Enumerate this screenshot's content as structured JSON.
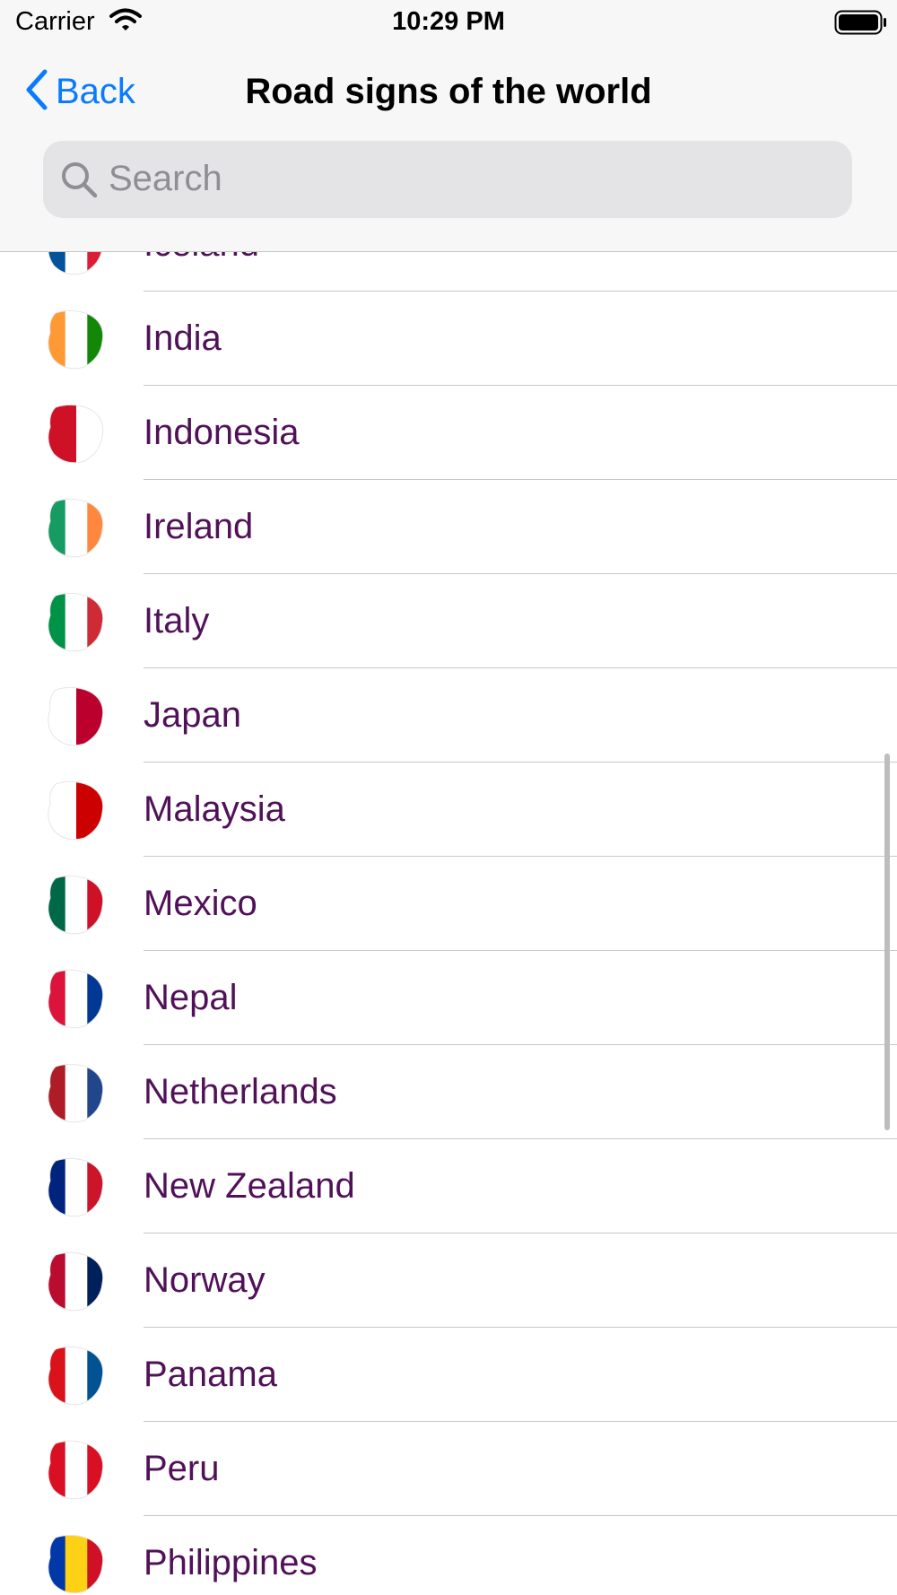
{
  "status_bar": {
    "carrier": "Carrier",
    "time": "10:29 PM"
  },
  "nav": {
    "back_label": "Back",
    "title": "Road signs of the world"
  },
  "search": {
    "placeholder": "Search"
  },
  "accent_color": "#0a7aff",
  "row_text_color": "#511159",
  "countries": [
    {
      "name": "Iceland",
      "icon": "iceland-flag-map-icon",
      "colors": [
        "#02529c",
        "#ffffff",
        "#dc1e35"
      ]
    },
    {
      "name": "India",
      "icon": "india-flag-map-icon",
      "colors": [
        "#ff9933",
        "#ffffff",
        "#138808"
      ]
    },
    {
      "name": "Indonesia",
      "icon": "indonesia-flag-map-icon",
      "colors": [
        "#ce1126",
        "#ffffff"
      ]
    },
    {
      "name": "Ireland",
      "icon": "ireland-flag-map-icon",
      "colors": [
        "#169b62",
        "#ffffff",
        "#ff883e"
      ]
    },
    {
      "name": "Italy",
      "icon": "italy-flag-map-icon",
      "colors": [
        "#009246",
        "#ffffff",
        "#ce2b37"
      ]
    },
    {
      "name": "Japan",
      "icon": "japan-flag-map-icon",
      "colors": [
        "#ffffff",
        "#bc002d"
      ]
    },
    {
      "name": "Malaysia",
      "icon": "malaysia-flag-map-icon",
      "colors": [
        "#ffffff",
        "#cc0001"
      ]
    },
    {
      "name": "Mexico",
      "icon": "mexico-flag-map-icon",
      "colors": [
        "#006847",
        "#ffffff",
        "#ce1126"
      ]
    },
    {
      "name": "Nepal",
      "icon": "nepal-flag-map-icon",
      "colors": [
        "#dc143c",
        "#ffffff",
        "#003893"
      ]
    },
    {
      "name": "Netherlands",
      "icon": "netherlands-flag-map-icon",
      "colors": [
        "#ae1c28",
        "#ffffff",
        "#21468b"
      ]
    },
    {
      "name": "New Zealand",
      "icon": "new-zealand-flag-map-icon",
      "colors": [
        "#00247d",
        "#ffffff",
        "#cc142b"
      ]
    },
    {
      "name": "Norway",
      "icon": "norway-flag-map-icon",
      "colors": [
        "#ba0c2f",
        "#ffffff",
        "#00205b"
      ]
    },
    {
      "name": "Panama",
      "icon": "panama-flag-map-icon",
      "colors": [
        "#da121a",
        "#ffffff",
        "#005293"
      ]
    },
    {
      "name": "Peru",
      "icon": "peru-flag-map-icon",
      "colors": [
        "#d91023",
        "#ffffff",
        "#d91023"
      ]
    },
    {
      "name": "Philippines",
      "icon": "philippines-flag-map-icon",
      "colors": [
        "#0038a8",
        "#fcd116",
        "#ce1126"
      ]
    }
  ]
}
